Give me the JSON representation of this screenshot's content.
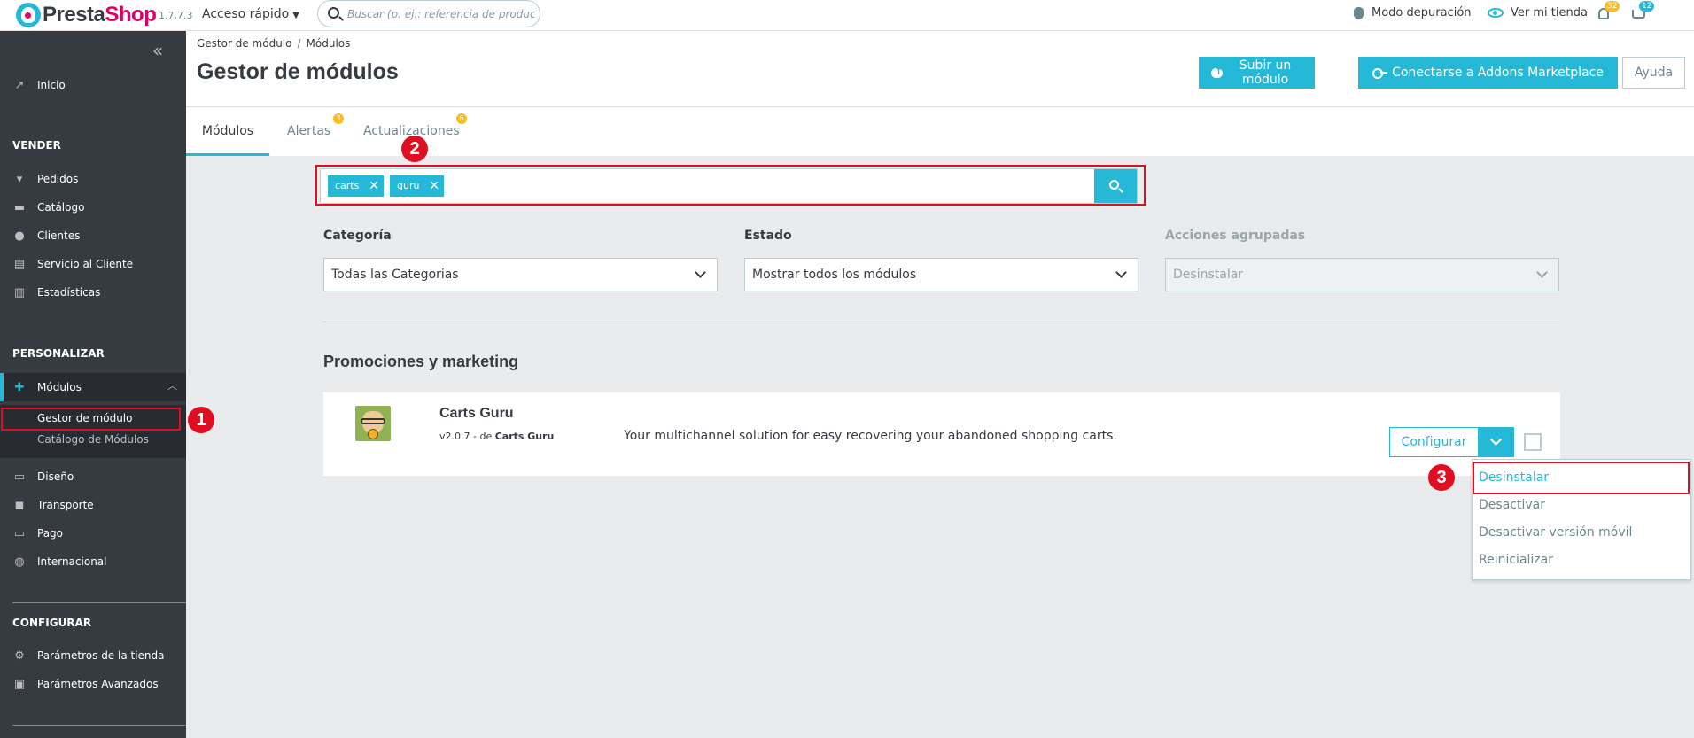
{
  "header": {
    "brand_presta": "Presta",
    "brand_shop": "Shop",
    "version": "1.7.7.3",
    "quick_access": "Acceso rápido",
    "search_placeholder": "Buscar (p. ej.: referencia de producto, no",
    "debug_mode": "Modo depuración",
    "view_store": "Ver mi tienda",
    "notif_count": "32",
    "cart_count": "12"
  },
  "sidebar": {
    "inicio": "Inicio",
    "sell_heading": "VENDER",
    "sell_items": [
      "Pedidos",
      "Catálogo",
      "Clientes",
      "Servicio al Cliente",
      "Estadísticas"
    ],
    "personalize_heading": "PERSONALIZAR",
    "modules": "Módulos",
    "module_sub": [
      "Gestor de módulo",
      "Catálogo de Módulos"
    ],
    "personalize_items": [
      "Diseño",
      "Transporte",
      "Pago",
      "Internacional"
    ],
    "configure_heading": "CONFIGURAR",
    "configure_items": [
      "Parámetros de la tienda",
      "Parámetros Avanzados"
    ]
  },
  "page": {
    "breadcrumb": [
      "Gestor de módulo",
      "Módulos"
    ],
    "title": "Gestor de módulos",
    "btn_upload": "Subir un módulo",
    "btn_addons": "Conectarse a Addons Marketplace",
    "btn_help": "Ayuda"
  },
  "tabs": [
    {
      "label": "Módulos",
      "badge": ""
    },
    {
      "label": "Alertas",
      "badge": "3"
    },
    {
      "label": "Actualizaciones",
      "badge": "6"
    }
  ],
  "search_tags": [
    "carts",
    "guru"
  ],
  "filters": {
    "category_label": "Categoría",
    "category_value": "Todas las Categorias",
    "status_label": "Estado",
    "status_value": "Mostrar todos los módulos",
    "bulk_label": "Acciones agrupadas",
    "bulk_value": "Desinstalar"
  },
  "section_title": "Promociones y marketing",
  "module": {
    "name": "Carts Guru",
    "version": "v2.0.7 - de",
    "author": "Carts Guru",
    "description": "Your multichannel solution for easy recovering your abandoned shopping carts.",
    "configure": "Configurar"
  },
  "dropdown": [
    "Desinstalar",
    "Desactivar",
    "Desactivar versión móvil",
    "Reinicializar"
  ],
  "steps": [
    "1",
    "2",
    "3"
  ],
  "colors": {
    "accent": "#25b9d7",
    "sidebar": "#363a41",
    "highlight": "#e10e22",
    "badge": "#fbbb22"
  }
}
